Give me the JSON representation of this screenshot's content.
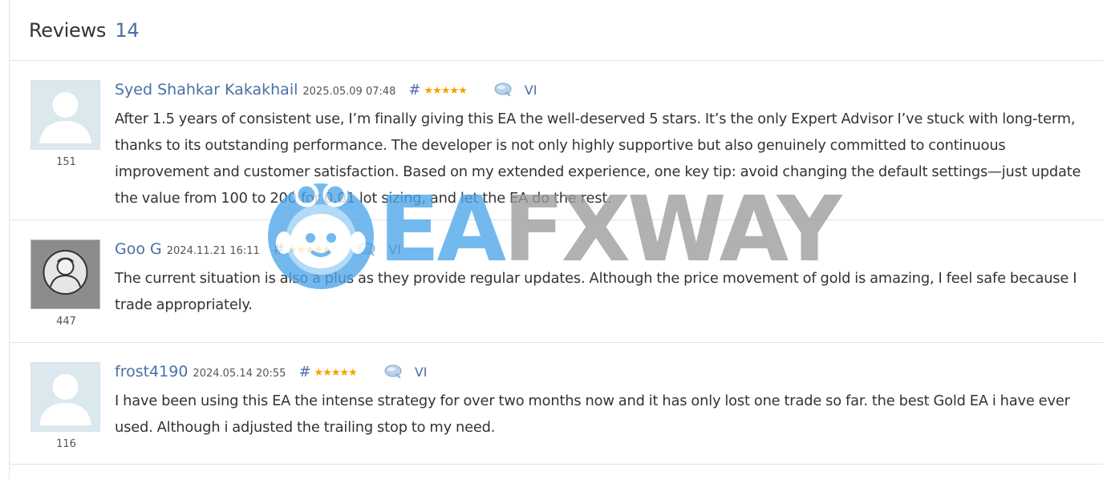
{
  "header": {
    "title": "Reviews",
    "count": "14"
  },
  "reviews": [
    {
      "author": "Syed Shahkar Kakakhail",
      "date": "2025.05.09 07:48",
      "hash": "#",
      "rating": 5,
      "lang": "VI",
      "user_rating": "151",
      "avatar": "default-avatar-icon",
      "text": "After 1.5 years of consistent use, I’m finally giving this EA the well-deserved 5 stars. It’s the only Expert Advisor I’ve stuck with long-term, thanks to its outstanding performance. The developer is not only highly supportive but also genuinely committed to continuous improvement and customer satisfaction. Based on my extended experience, one key tip: avoid changing the default settings—just update the value from 100 to 200 for 0.01 lot sizing, and let the EA do the rest."
    },
    {
      "author": "Goo G",
      "date": "2024.11.21 16:11",
      "hash": "#",
      "rating": 5,
      "lang": "VI",
      "user_rating": "447",
      "avatar": "user-photo-avatar",
      "text": "The current situation is also a plus as they provide regular updates. Although the price movement of gold is amazing, I feel safe because I trade appropriately."
    },
    {
      "author": "frost4190",
      "date": "2024.05.14 20:55",
      "hash": "#",
      "rating": 5,
      "lang": "VI",
      "user_rating": "116",
      "avatar": "default-avatar-icon",
      "text": "I have been using this EA the intense strategy for over two months now and it has only lost one trade so far. the best Gold EA i have ever used. Although i adjusted the trailing stop to my need."
    }
  ],
  "watermark": {
    "part1": "EA",
    "part2": "FXWAY"
  },
  "colors": {
    "link": "#4a6fa5",
    "star": "#f5a100",
    "text": "#333333",
    "watermark_blue": "#4da6ea",
    "watermark_gray": "#9c9c9c"
  }
}
